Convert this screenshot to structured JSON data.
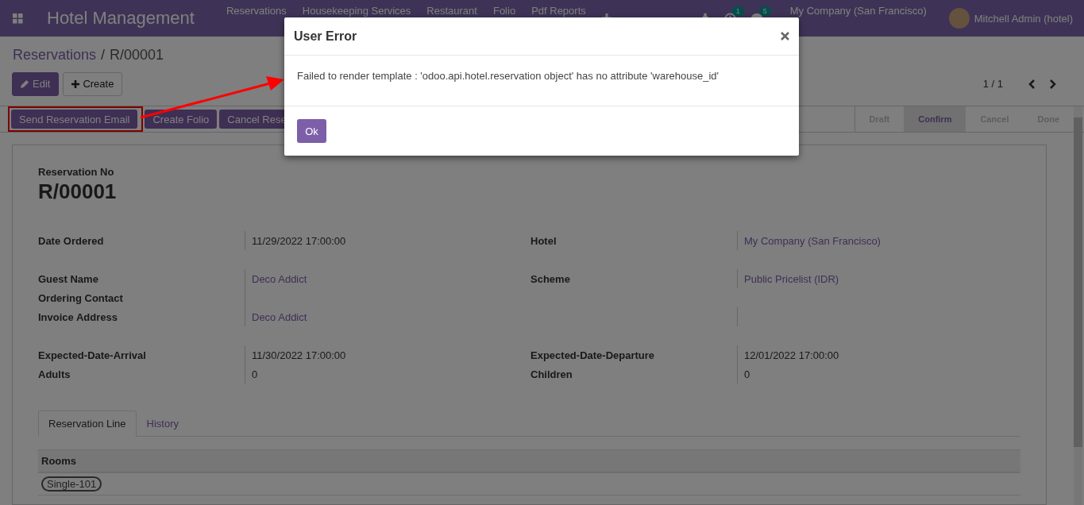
{
  "navbar": {
    "app_title": "Hotel Management",
    "menu": [
      "Reservations",
      "Housekeeping Services",
      "Restaurant",
      "Folio",
      "Pdf Reports"
    ],
    "activity_count": "1",
    "message_count": "5",
    "company": "My Company (San Francisco)",
    "user": "Mitchell Admin (hotel)"
  },
  "breadcrumb": {
    "parent": "Reservations",
    "separator": "/",
    "current": "R/00001"
  },
  "actions": {
    "edit": "Edit",
    "create": "Create"
  },
  "pager": "1 / 1",
  "header_buttons": [
    {
      "label": "Send Reservation Email",
      "highlighted": true
    },
    {
      "label": "Create Folio",
      "highlighted": false
    },
    {
      "label": "Cancel Rese",
      "highlighted": false
    }
  ],
  "statusbar": [
    {
      "label": "Draft",
      "selected": false
    },
    {
      "label": "Confirm",
      "selected": true
    },
    {
      "label": "Cancel",
      "selected": false
    },
    {
      "label": "Done",
      "selected": false
    }
  ],
  "form": {
    "number_label": "Reservation No",
    "number": "R/00001",
    "groups": [
      {
        "rows": [
          {
            "left": {
              "label": "Date Ordered",
              "value": "11/29/2022 17:00:00",
              "link": false
            },
            "right": {
              "label": "Hotel",
              "value": "My Company (San Francisco)",
              "link": true
            }
          }
        ]
      },
      {
        "rows": [
          {
            "left": {
              "label": "Guest Name",
              "value": "Deco Addict",
              "link": true
            },
            "right": {
              "label": "Scheme",
              "value": "Public Pricelist (IDR)",
              "link": true
            }
          },
          {
            "left": {
              "label": "Ordering Contact"
            }
          },
          {
            "left": {
              "label": "Invoice Address",
              "value": "Deco Addict",
              "link": true
            },
            "right": {}
          }
        ]
      },
      {
        "rows": [
          {
            "left": {
              "label": "Expected-Date-Arrival",
              "value": "11/30/2022 17:00:00",
              "link": false
            },
            "right": {
              "label": "Expected-Date-Departure",
              "value": "12/01/2022 17:00:00",
              "link": false
            }
          },
          {
            "left": {
              "label": "Adults",
              "value": "0",
              "link": false
            },
            "right": {
              "label": "Children",
              "value": "0",
              "link": false
            }
          }
        ]
      }
    ],
    "tabs": [
      {
        "label": "Reservation Line",
        "selected": true
      },
      {
        "label": "History",
        "selected": false
      }
    ],
    "table": {
      "columns": [
        "Rooms"
      ],
      "rows": [
        {
          "rooms": [
            "Single-101"
          ]
        }
      ]
    }
  },
  "dialog": {
    "title": "User Error",
    "message": "Failed to render template : 'odoo.api.hotel.reservation object' has no attribute 'warehouse_id'",
    "ok": "Ok"
  }
}
